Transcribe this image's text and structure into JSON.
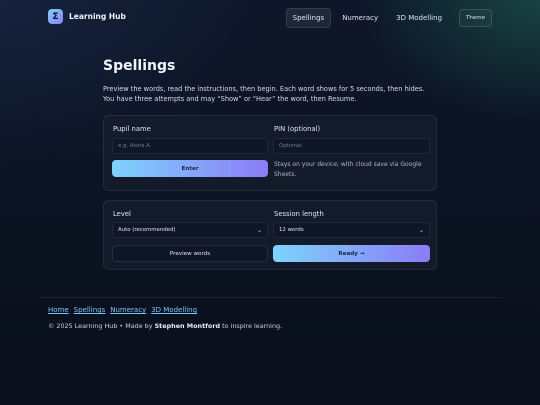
{
  "brand": {
    "name": "Learning Hub",
    "logo_glyph": "Σ",
    "logo_colors": [
      "#7dd3fc",
      "#8b7cf6"
    ]
  },
  "nav": {
    "items": [
      {
        "label": "Spellings",
        "active": true
      },
      {
        "label": "Numeracy",
        "active": false
      },
      {
        "label": "3D Modelling",
        "active": false
      }
    ],
    "theme_label": "Theme"
  },
  "main": {
    "title": "Spellings",
    "intro": "Preview the words, read the instructions, then begin. Each word shows for 5 seconds, then hides. You have three attempts and may “Show” or “Hear” the word, then Resume."
  },
  "pupil_card": {
    "name_label": "Pupil name",
    "name_placeholder": "e.g. Aisha A.",
    "pin_label": "PIN (optional)",
    "pin_placeholder": "Optional",
    "enter_label": "Enter",
    "note": "Stays on your device; with cloud save via Google Sheets."
  },
  "session_card": {
    "level_label": "Level",
    "level_value": "Auto (recommended)",
    "length_label": "Session length",
    "length_value": "12 words",
    "preview_label": "Preview words",
    "ready_label": "Ready →"
  },
  "footer": {
    "links": [
      "Home",
      "Spellings",
      "Numeracy",
      "3D Modelling"
    ],
    "copyright_prefix": "© 2025 Learning Hub • Made by",
    "author": "Stephen Montford",
    "copyright_suffix": "to inspire learning."
  },
  "colors": {
    "background": "#0b1220",
    "accent_start": "#7dd3fc",
    "accent_end": "#8b7cf6",
    "link": "#7cc4f5"
  }
}
